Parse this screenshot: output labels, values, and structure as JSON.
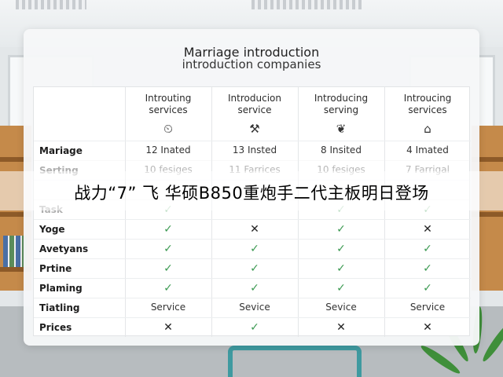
{
  "card": {
    "title": "Marriage introduction",
    "subtitle": "introduction companies"
  },
  "columns": [
    {
      "label_line1": "Introuting",
      "label_line2": "services",
      "icon": "clock-icon",
      "glyph": "⏲"
    },
    {
      "label_line1": "Introducion",
      "label_line2": "service",
      "icon": "tools-icon",
      "glyph": "⚒"
    },
    {
      "label_line1": "Introducing",
      "label_line2": "serving",
      "icon": "leaf-icon",
      "glyph": "❦"
    },
    {
      "label_line1": "Introucing",
      "label_line2": "services",
      "icon": "house-icon",
      "glyph": "⌂"
    }
  ],
  "rows": [
    {
      "label": "Mariage",
      "cells": [
        "12 Inated",
        "13 Insted",
        "8 Insited",
        "4 Imated"
      ],
      "faded": false
    },
    {
      "label": "Serting",
      "cells": [
        "10 fesiges",
        "11 Farrices",
        "10 fesiges",
        "7 Farrigal"
      ],
      "faded": true
    },
    {
      "label": "",
      "cells": [
        "",
        "",
        "",
        ""
      ],
      "faded": true
    },
    {
      "label": "Task",
      "cells": [
        "✓",
        "",
        "✓",
        "✓"
      ],
      "faded": true
    },
    {
      "label": "Yoge",
      "cells": [
        "✓",
        "✕",
        "✓",
        "✕"
      ],
      "faded": false
    },
    {
      "label": "Avetyans",
      "cells": [
        "✓",
        "✓",
        "✓",
        "✓"
      ],
      "faded": false
    },
    {
      "label": "Prtine",
      "cells": [
        "✓",
        "✓",
        "✓",
        "✓"
      ],
      "faded": false
    },
    {
      "label": "Plaming",
      "cells": [
        "✓",
        "✓",
        "✓",
        "✓"
      ],
      "faded": false
    },
    {
      "label": "Tiatling",
      "cells": [
        "Service",
        "Sevice",
        "Sevice",
        "Service"
      ],
      "faded": false
    },
    {
      "label": "Prices",
      "cells": [
        "✕",
        "✓",
        "✕",
        "✕"
      ],
      "faded": false
    }
  ],
  "banner": {
    "text": "战力“7” 飞 华硕B850重炮手二代主板明日登场"
  },
  "colors": {
    "check": "#3c9a52",
    "cross": "#222222",
    "accent_chair": "#3f9aa0"
  }
}
